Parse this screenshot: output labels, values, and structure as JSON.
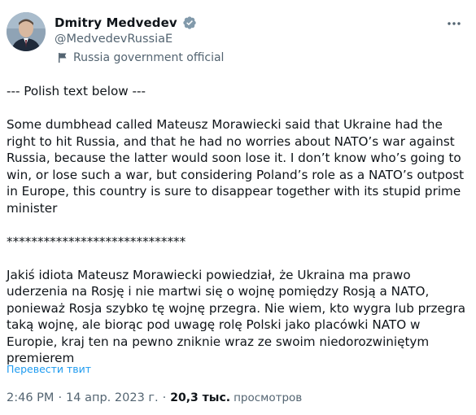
{
  "author": {
    "display_name": "Dmitry Medvedev",
    "handle": "@MedvedevRussiaE",
    "label": "Russia government official",
    "verified_badge_color": "#829aab"
  },
  "icons": {
    "avatar": "avatar-photo",
    "verified": "verified-badge-icon",
    "government": "flag-icon",
    "more": "more-options-icon"
  },
  "body": {
    "paragraphs": [
      "--- Polish text below ---",
      "Some dumbhead called Mateusz Morawiecki said that Ukraine had the right to hit Russia, and that he had no worries about NATO’s war against Russia, because the latter would soon lose it. I don’t know who’s going to win, or lose such a war, but considering Poland’s role as a NATO’s outpost in Europe, this country is sure to disappear together with its stupid prime minister",
      "*****************************",
      "Jakiś idiota Mateusz Morawiecki powiedział, że Ukraina ma prawo uderzenia na Rosję i nie martwi się o wojnę pomiędzy Rosją a NATO, ponieważ Rosja szybko tę wojnę przegra. Nie wiem, kto wygra lub przegra taką wojnę, ale biorąc pod uwagę rolę Polski jako placówki NATO w Europie, kraj ten na pewno zniknie wraz ze swoim niedorozwiniętym premierem"
    ],
    "translate_label": "Перевести твит"
  },
  "meta": {
    "time": "2:46 PM",
    "separator": "·",
    "date": "14 апр. 2023 г.",
    "views_count": "20,3 тыс.",
    "views_label": "просмотров"
  },
  "colors": {
    "text_primary": "#0f1419",
    "text_secondary": "#536471",
    "link": "#1d9bf0"
  }
}
